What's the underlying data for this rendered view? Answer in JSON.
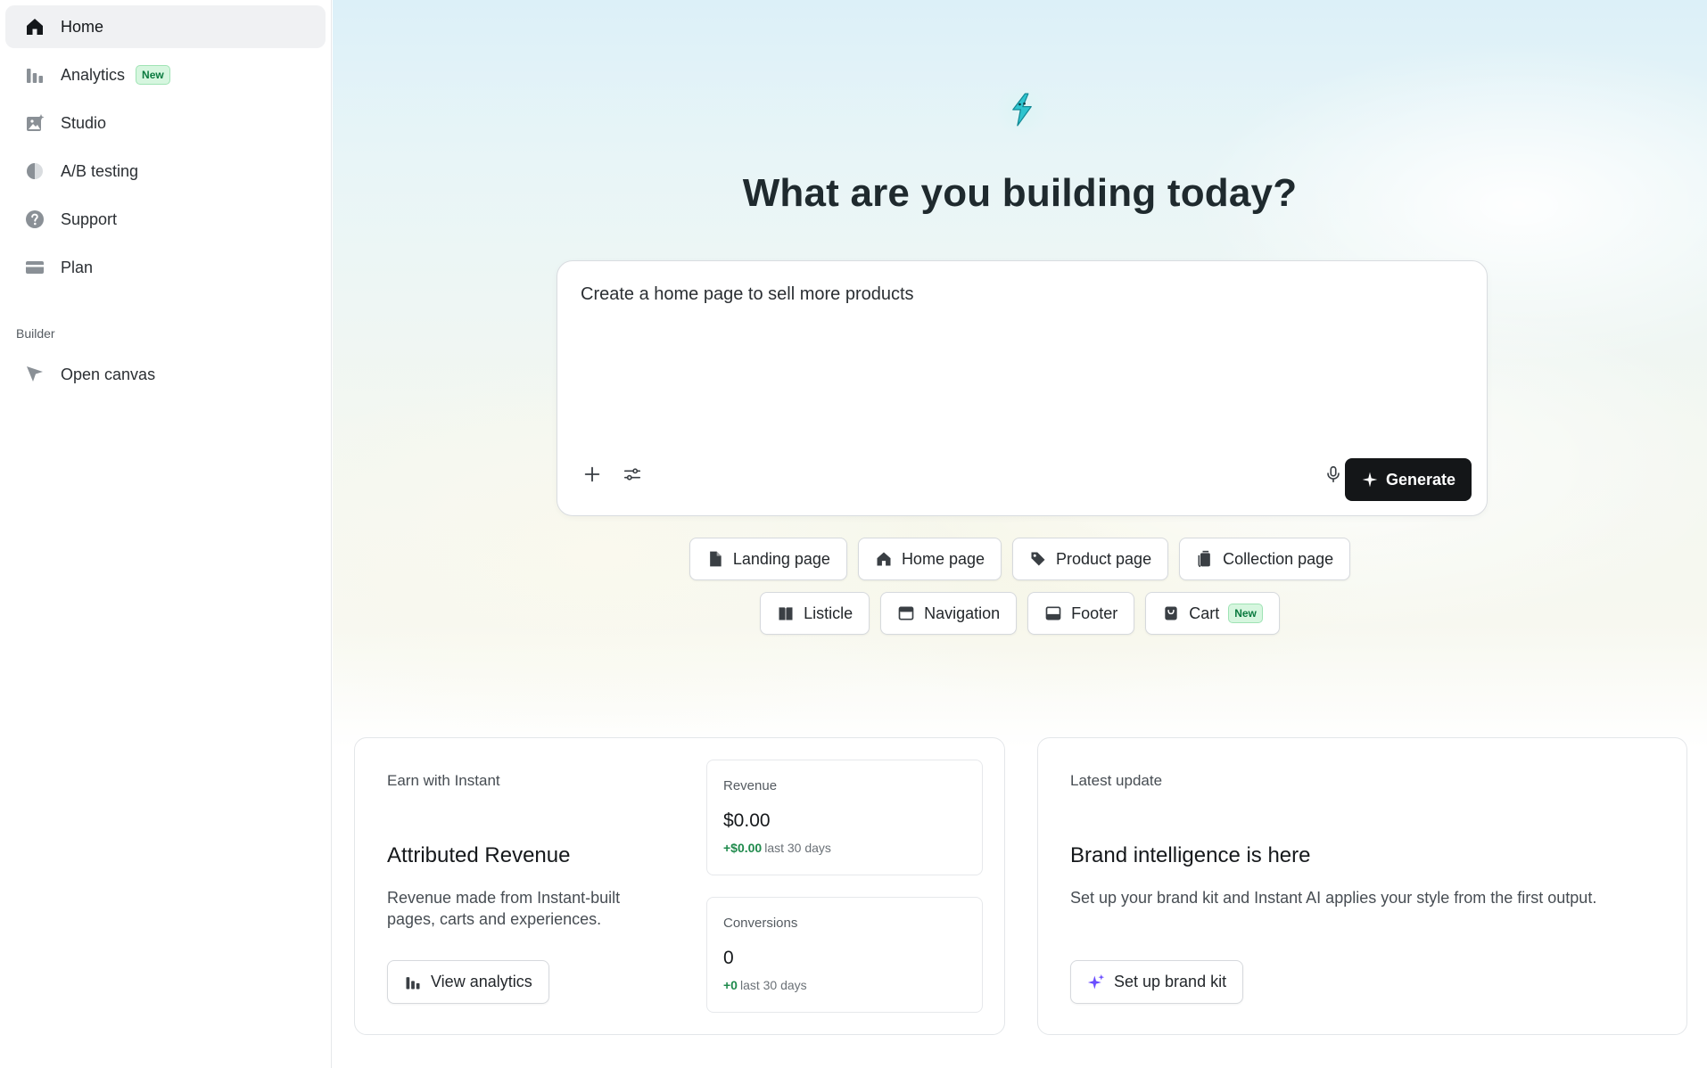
{
  "sidebar": {
    "items": [
      {
        "label": "Home",
        "icon": "home-icon",
        "active": true
      },
      {
        "label": "Analytics",
        "icon": "bar-chart-icon",
        "badge": "New"
      },
      {
        "label": "Studio",
        "icon": "image-sparkle-icon"
      },
      {
        "label": "A/B testing",
        "icon": "half-circle-icon"
      },
      {
        "label": "Support",
        "icon": "question-circle-icon"
      },
      {
        "label": "Plan",
        "icon": "credit-card-icon"
      }
    ],
    "builder_label": "Builder",
    "builder_items": [
      {
        "label": "Open canvas",
        "icon": "cursor-arrow-icon"
      }
    ]
  },
  "hero": {
    "title": "What are you building today?"
  },
  "prompt": {
    "value": "Create a home page to sell more products",
    "generate_label": "Generate"
  },
  "templates": {
    "row1": [
      {
        "label": "Landing page",
        "icon": "file-icon"
      },
      {
        "label": "Home page",
        "icon": "home-icon"
      },
      {
        "label": "Product page",
        "icon": "tag-icon"
      },
      {
        "label": "Collection page",
        "icon": "copy-icon"
      }
    ],
    "row2": [
      {
        "label": "Listicle",
        "icon": "book-icon"
      },
      {
        "label": "Navigation",
        "icon": "window-icon"
      },
      {
        "label": "Footer",
        "icon": "footer-icon"
      },
      {
        "label": "Cart",
        "icon": "bag-icon",
        "badge": "New"
      }
    ]
  },
  "earn_card": {
    "eyebrow": "Earn with Instant",
    "title": "Attributed Revenue",
    "description": "Revenue made from Instant-built pages, carts and experiences.",
    "button": "View analytics",
    "revenue": {
      "label": "Revenue",
      "value": "$0.00",
      "delta": "+$0.00",
      "period": "last 30 days"
    },
    "conversions": {
      "label": "Conversions",
      "value": "0",
      "delta": "+0",
      "period": "last 30 days"
    }
  },
  "update_card": {
    "eyebrow": "Latest update",
    "title": "Brand intelligence is here",
    "description": "Set up your brand kit and Instant AI applies your style from the first output.",
    "button": "Set up brand kit"
  },
  "colors": {
    "accent_dark": "#141618",
    "badge_green": "#0a7a3f",
    "positive_green": "#1f8a4c",
    "logo_teal": "#2ec4cf",
    "sparkle_purple": "#6b4eff"
  }
}
